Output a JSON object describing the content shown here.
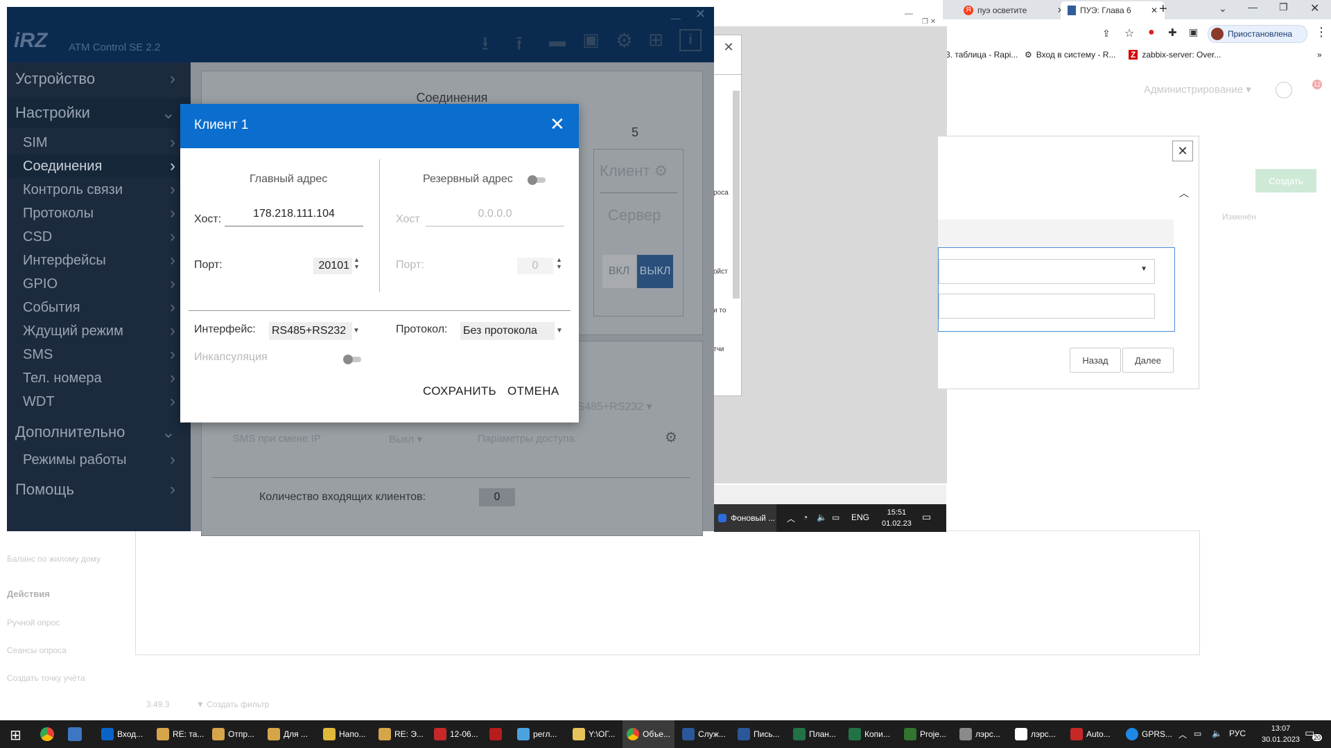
{
  "browser": {
    "tabs": [
      {
        "label": "пуэ осветите",
        "icon": "yandex-icon"
      },
      {
        "label": "ПУЭ: Глава 6",
        "icon": "doc-icon"
      }
    ],
    "paused_label": "Приостановлена",
    "bookmarks": [
      "3. таблица - Rapi...",
      "Вход в систему - R...",
      "zabbix-server: Over..."
    ],
    "admin_label": "Администрирование",
    "notify_count": "12",
    "create_button": "Создать",
    "changed_col": "Изменён"
  },
  "background_app": {
    "left_items": [
      "Баланс по жилому дому"
    ],
    "actions_title": "Действия",
    "actions": [
      "Ручной опрос",
      "Сеансы опроса",
      "Создать точку учёта"
    ],
    "version": "3.49.3",
    "filter_label": "Создать фильтр",
    "wizard_back": "Назад",
    "wizard_next": "Далее"
  },
  "atm": {
    "brand": "iRZ",
    "title": "ATM Control SE 2.2",
    "sidebar": [
      {
        "label": "Устройство",
        "level": 0,
        "chevron": ">"
      },
      {
        "label": "Настройки",
        "level": 0,
        "chevron": "v"
      },
      {
        "label": "SIM",
        "level": 1,
        "chevron": ">"
      },
      {
        "label": "Соединения",
        "level": 1,
        "chevron": ">",
        "active": true
      },
      {
        "label": "Контроль связи",
        "level": 1,
        "chevron": ">"
      },
      {
        "label": "Протоколы",
        "level": 1,
        "chevron": ">"
      },
      {
        "label": "CSD",
        "level": 1,
        "chevron": ">"
      },
      {
        "label": "Интерфейсы",
        "level": 1,
        "chevron": ">"
      },
      {
        "label": "GPIO",
        "level": 1,
        "chevron": ">"
      },
      {
        "label": "События",
        "level": 1,
        "chevron": ">"
      },
      {
        "label": "Ждущий режим",
        "level": 1,
        "chevron": ">"
      },
      {
        "label": "SMS",
        "level": 1,
        "chevron": ">"
      },
      {
        "label": "Тел. номера",
        "level": 1,
        "chevron": ">"
      },
      {
        "label": "WDT",
        "level": 1,
        "chevron": ">"
      },
      {
        "label": "Дополнительно",
        "level": 0,
        "chevron": "v"
      },
      {
        "label": "Режимы работы",
        "level": 1,
        "chevron": ">"
      },
      {
        "label": "Помощь",
        "level": 0,
        "chevron": ">"
      }
    ],
    "content": {
      "section_title": "Соединения",
      "slot_number": "5",
      "client_label": "Клиент",
      "server_label": "Сервер",
      "on_label": "ВКЛ",
      "off_label": "ВЫКЛ",
      "iface_value": "RS485+RS232",
      "sms_ip_label": "SMS при смене IP",
      "sms_ip_value": "Выкл",
      "access_label": "Параметры доступа:",
      "incoming_label": "Количество входящих клиентов:",
      "incoming_value": "0"
    }
  },
  "modal": {
    "title": "Клиент 1",
    "main_addr": "Главный адрес",
    "reserve_addr": "Резервный адрес",
    "host_label": "Хост:",
    "host_value": "178.218.111.104",
    "reserve_host_label": "Хост",
    "reserve_host_value": "0.0.0.0",
    "port_label": "Порт:",
    "port_value": "20101",
    "reserve_port_label": "Порт:",
    "reserve_port_value": "0",
    "iface_label": "Интерфейс:",
    "iface_value": "RS485+RS232",
    "proto_label": "Протокол:",
    "proto_value": "Без протокола",
    "encap_label": "Инкапсуляция",
    "save": "СОХРАНИТЬ",
    "cancel": "ОТМЕНА"
  },
  "mini_taskbar": {
    "app": "Фоновый ...",
    "lang": "ENG",
    "time": "15:51",
    "date": "01.02.23"
  },
  "midwin_texts": [
    "роса",
    "ойст",
    "и то",
    "тчи"
  ],
  "taskbar": {
    "items": [
      "Вход...",
      "RE: та...",
      "Отпр...",
      "Для ...",
      "Напо...",
      "RE: Э...",
      "12-06...",
      "",
      "регл...",
      "Y:\\ОГ...",
      "Объе...",
      "Служ...",
      "Пись...",
      "План...",
      "Копи...",
      "Proje...",
      "лэрс...",
      "лэрс...",
      "Auto...",
      "GPRS..."
    ],
    "lang": "РУС",
    "time": "13:07",
    "date": "30.01.2023",
    "notif_count": "20"
  }
}
